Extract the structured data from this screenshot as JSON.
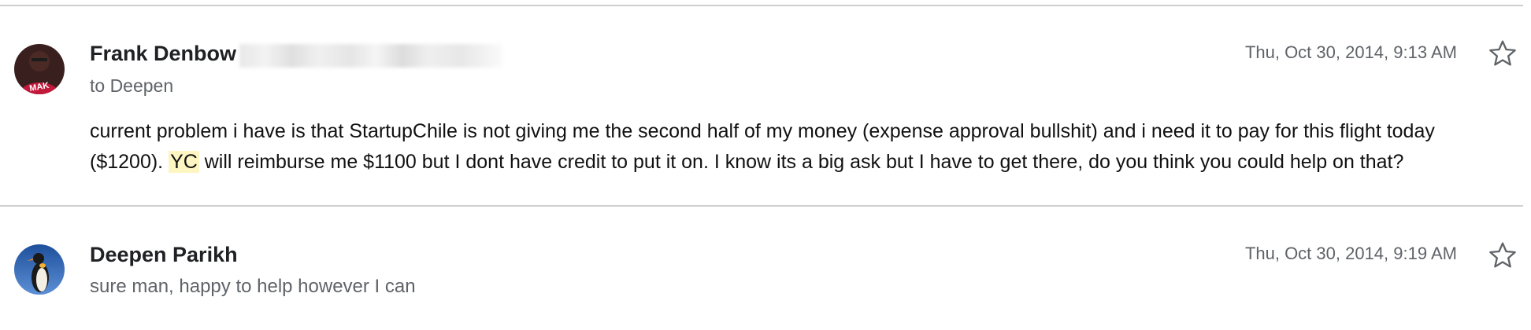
{
  "messages": [
    {
      "sender": "Frank Denbow",
      "recipient": "to Deepen",
      "timestamp": "Thu, Oct 30, 2014, 9:13 AM",
      "body_part1": "current problem i have is that StartupChile is not giving me the second half of my money (expense approval bullshit) and i need it to pay for this flight today ($1200). ",
      "body_highlight": "YC",
      "body_part2": " will reimburse me $1100 but I dont have credit to put it on. I know its a big ask but I have to get there, do you think you could help on that?",
      "avatar_icon": "avatar-photo",
      "avatar_text": "MAK"
    },
    {
      "sender": "Deepen Parikh",
      "snippet": "sure man, happy to help however I can",
      "timestamp": "Thu, Oct 30, 2014, 9:19 AM",
      "avatar_icon": "penguin-avatar"
    }
  ],
  "colors": {
    "highlight": "#fdf6c3",
    "secondary_text": "#5f6368",
    "divider": "#cfcfcf"
  }
}
